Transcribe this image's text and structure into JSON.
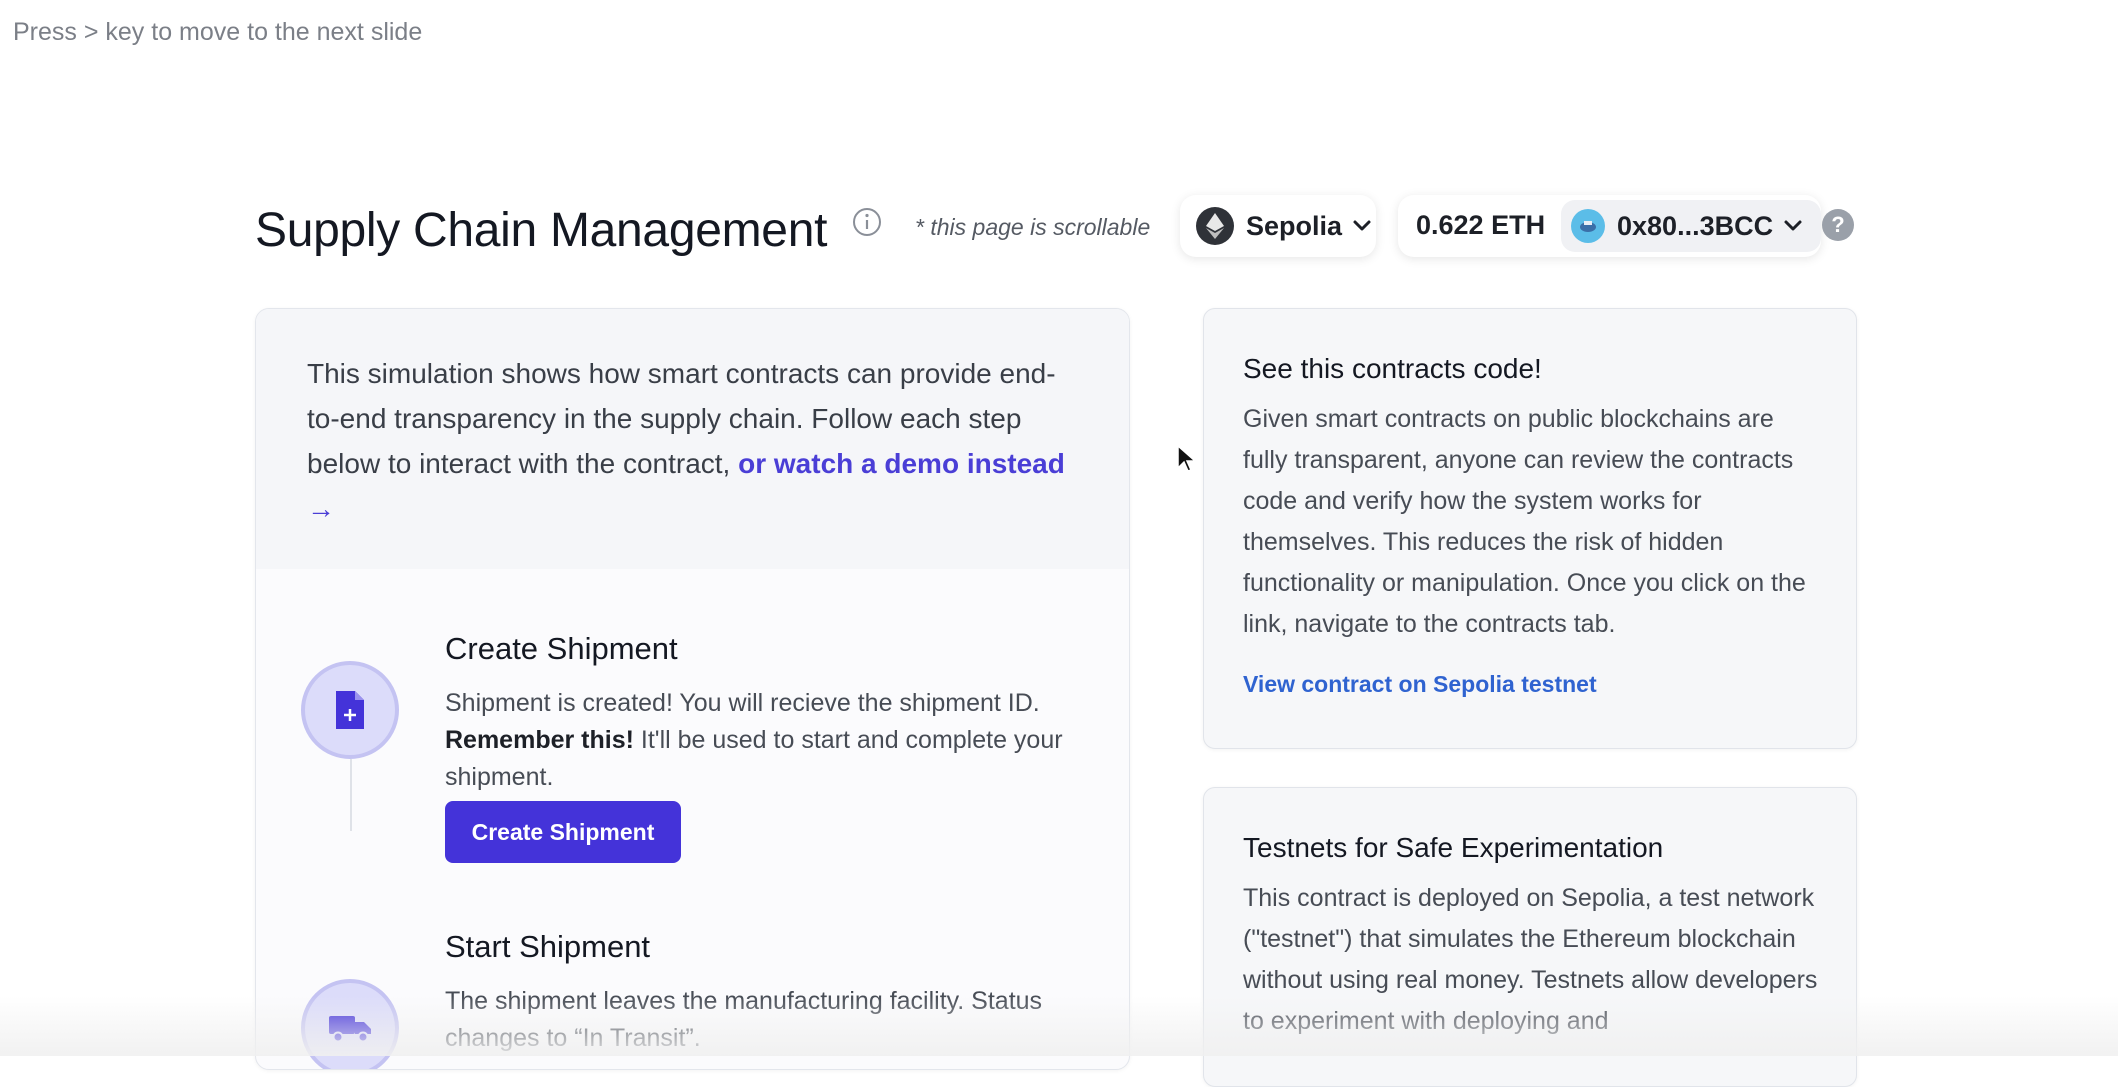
{
  "hint": "Press > key to move to the next slide",
  "header": {
    "title": "Supply Chain Management",
    "scroll_note": "* this page is scrollable",
    "network": "Sepolia",
    "balance": "0.622 ETH",
    "address": "0x80...3BCC",
    "help": "?"
  },
  "intro": {
    "text": "This simulation shows how smart contracts can provide end-to-end transparency in the supply chain. Follow each step below to interact with the contract, ",
    "link": "or watch a demo instead",
    "arrow": "→"
  },
  "steps": [
    {
      "title": "Create Shipment",
      "desc_prefix": "Shipment is created! You will recieve the shipment ID. ",
      "desc_bold": "Remember this!",
      "desc_suffix": " It'll be used to start and complete your shipment.",
      "button": "Create Shipment",
      "icon": "document-plus-icon"
    },
    {
      "title": "Start Shipment",
      "desc": "The shipment leaves the manufacturing facility. Status changes to “In Transit”.",
      "icon": "truck-icon"
    }
  ],
  "cards": [
    {
      "title": "See this contracts code!",
      "body": "Given smart contracts on public blockchains are fully transparent, anyone can review the contracts code and verify how the system works for themselves. This reduces the risk of hidden functionality or manipulation. Once you click on the link, navigate to the contracts tab.",
      "link": "View contract on Sepolia testnet"
    },
    {
      "title": "Testnets for Safe Experimentation",
      "body": "This contract is deployed on Sepolia, a test network (\"testnet\") that simulates the Ethereum blockchain without using real money. Testnets allow developers to experiment with deploying and"
    }
  ],
  "colors": {
    "accent": "#4433d9",
    "link": "#2f63d0",
    "demo_link": "#4a3ed6"
  }
}
